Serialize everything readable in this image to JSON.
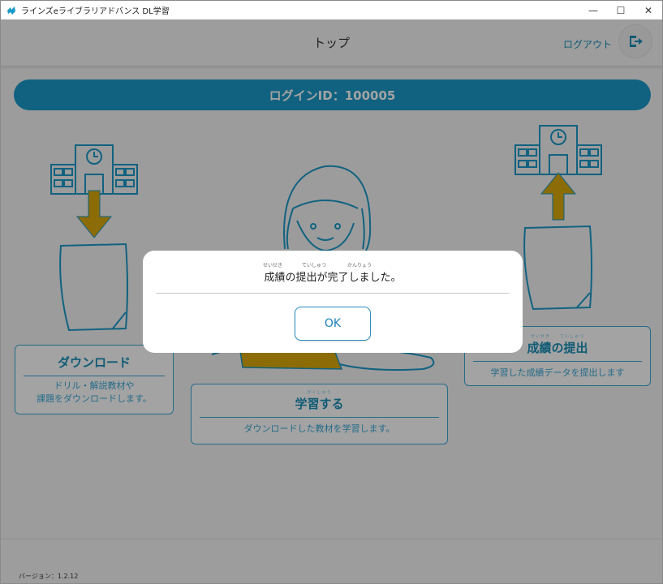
{
  "window": {
    "title": "ラインズeライブラリアドバンス DL学習",
    "controls": {
      "minimize": "—",
      "maximize": "☐",
      "close": "✕"
    }
  },
  "header": {
    "title": "トップ",
    "logout_label": "ログアウト"
  },
  "login_bar": {
    "text": "ログインID：100005"
  },
  "cards": {
    "download": {
      "title": "ダウンロード",
      "desc_line1": "ドリル・解説教材や",
      "desc_line2": "課題をダウンロードします。"
    },
    "study": {
      "ruby": "がくしゅう",
      "title": "学習する",
      "desc": "ダウンロードした教材を学習します。"
    },
    "submit": {
      "ruby": "せいせき　　ていしゅつ",
      "title": "成績の提出",
      "desc": "学習した成績データを提出します"
    }
  },
  "footer": {
    "version": "バージョン：1.2.12"
  },
  "dialog": {
    "ruby": [
      "せいせき",
      "ていしゅつ",
      "かんりょう"
    ],
    "message": "成績の提出が完了しました。",
    "ok_label": "OK"
  },
  "colors": {
    "accent": "#1c9ac9",
    "arrow": "#d9a90a",
    "line": "#3aa8d6"
  }
}
